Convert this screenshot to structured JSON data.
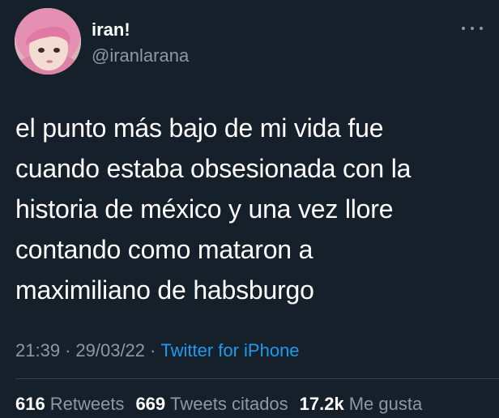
{
  "user": {
    "display_name": "iran!",
    "handle": "@iranlarana"
  },
  "tweet": {
    "text": "el punto más bajo de mi vida fue\ncuando estaba obsesionada con la\nhistoria de méxico y una vez llore\ncontando como mataron a\nmaximiliano de habsburgo"
  },
  "meta": {
    "time": "21:39",
    "separator": "·",
    "date": "29/03/22",
    "source": "Twitter for iPhone"
  },
  "stats": {
    "retweets_count": "616",
    "retweets_label": "Retweets",
    "quotes_count": "669",
    "quotes_label": "Tweets citados",
    "likes_count": "17.2k",
    "likes_label": "Me gusta"
  },
  "colors": {
    "background": "#15202b",
    "primary_text": "#ffffff",
    "secondary_text": "#8b98a5",
    "accent": "#1d9bf0",
    "divider": "#38444d"
  },
  "icons": {
    "more": "more-options-icon"
  }
}
